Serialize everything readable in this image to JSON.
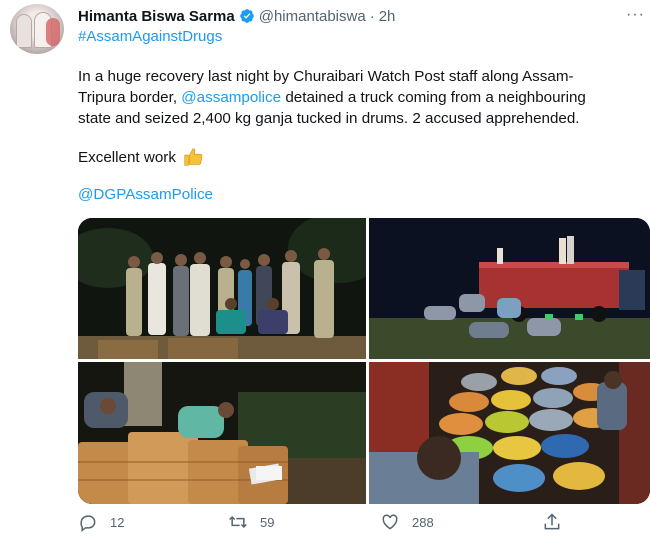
{
  "tweet": {
    "author_name": "Himanta Biswa Sarma",
    "handle": "@himantabiswa",
    "separator": "·",
    "time": "2h",
    "more": "···",
    "hashtag": "#AssamAgainstDrugs",
    "body_part1": "In a huge recovery last night by Churaibari Watch Post staff along Assam-\nTripura border, ",
    "body_mention": "@assampolice",
    "body_part2": " detained a truck coming from a neighbouring\nstate and seized 2,400 kg ganja tucked in drums. 2 accused apprehended.",
    "excellent": "Excellent work",
    "dgp_mention": "@DGPAssamPolice"
  },
  "actions": {
    "reply_count": "12",
    "retweet_count": "59",
    "like_count": "288"
  },
  "icons": [
    "verified-icon",
    "more-icon",
    "thumbs-up-icon",
    "reply-icon",
    "retweet-icon",
    "like-icon",
    "share-icon"
  ],
  "colors": {
    "link": "#1d9bf0",
    "text": "#0f1419",
    "muted": "#536471"
  }
}
